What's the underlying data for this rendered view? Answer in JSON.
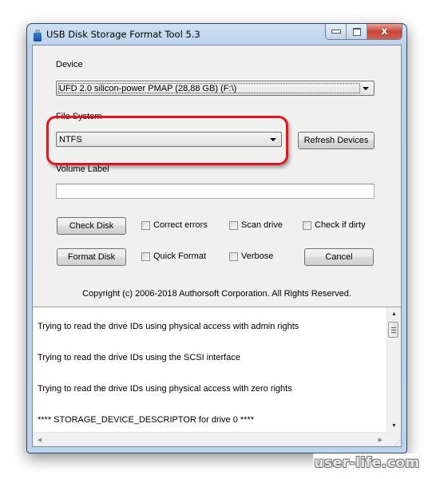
{
  "window": {
    "title": "USB Disk Storage Format Tool 5.3",
    "icon": "usb-drive-icon",
    "controls": {
      "minimize": "minimize-icon",
      "maximize": "maximize-icon",
      "close_glyph": "x"
    }
  },
  "device": {
    "label": "Device",
    "selected": "UFD 2.0  silicon-power  PMAP (28,88 GB) (F:\\)"
  },
  "file_system": {
    "label": "File System",
    "selected": "NTFS"
  },
  "refresh_button": "Refresh Devices",
  "volume_label": {
    "label": "Volume Label",
    "value": ""
  },
  "buttons": {
    "check_disk": "Check Disk",
    "format_disk": "Format Disk",
    "cancel": "Cancel"
  },
  "checkboxes": [
    {
      "label": "Correct errors",
      "checked": false
    },
    {
      "label": "Scan drive",
      "checked": false
    },
    {
      "label": "Check if dirty",
      "checked": false
    },
    {
      "label": "Quick Format",
      "checked": false
    },
    {
      "label": "Verbose",
      "checked": false
    }
  ],
  "copyright": "Copyright (c) 2006-2018 Authorsoft Corporation. All Rights Reserved.",
  "log": [
    "Trying to read the drive IDs using physical access with admin rights",
    "Trying to read the drive IDs using the SCSI interface",
    "Trying to read the drive IDs using physical access with zero rights",
    "**** STORAGE_DEVICE_DESCRIPTOR for drive 0 ****"
  ],
  "annotation": {
    "highlight_color": "#e3141b",
    "target": "file-system-combo"
  },
  "watermark": "user-life.com"
}
